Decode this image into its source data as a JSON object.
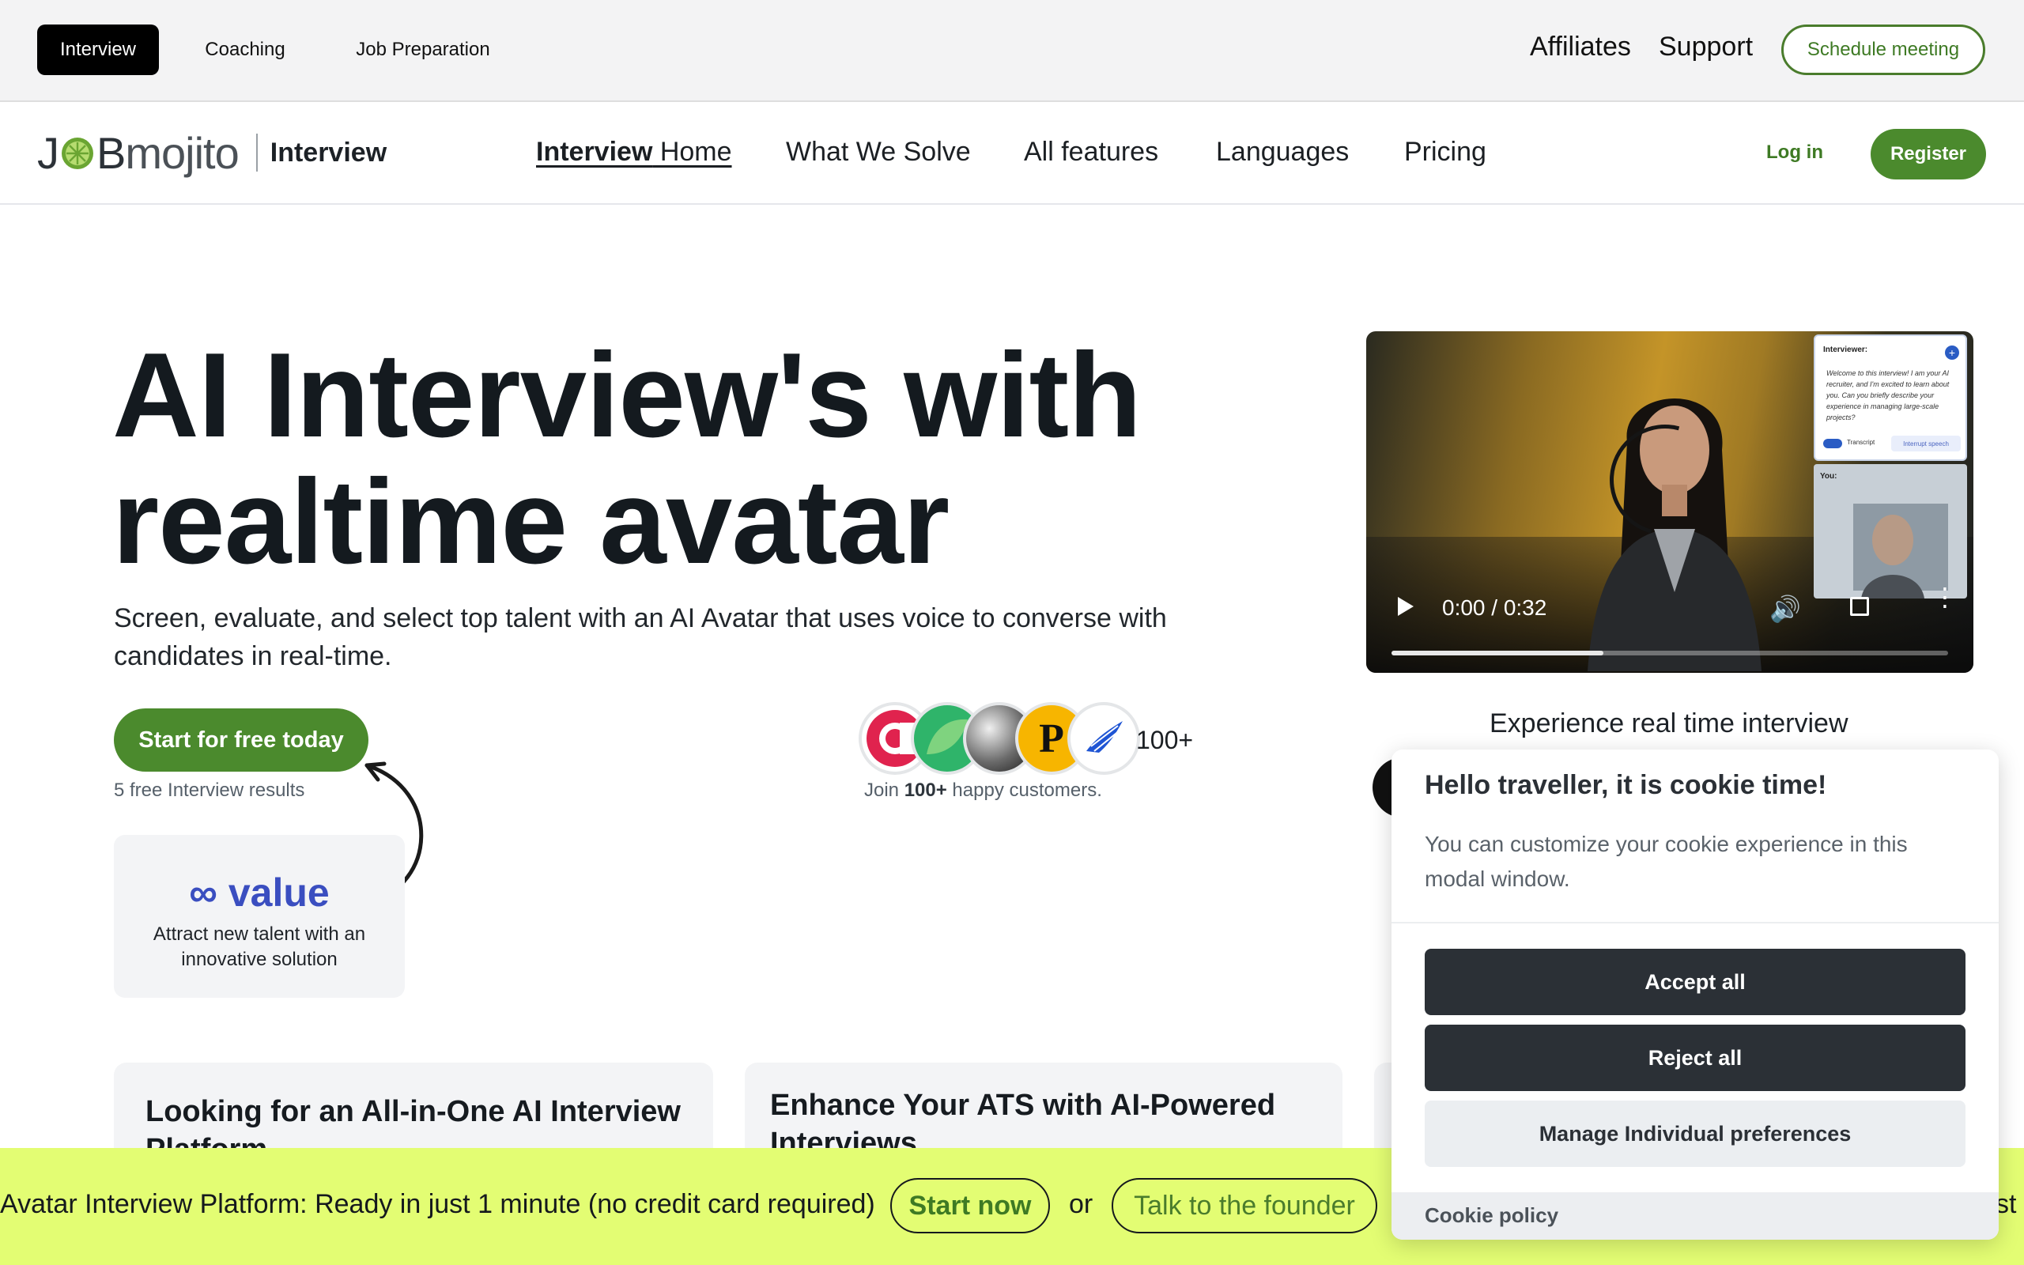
{
  "topbar": {
    "tabs": [
      "Interview",
      "Coaching",
      "Job Preparation"
    ],
    "links": [
      "Affiliates",
      "Support"
    ],
    "schedule_label": "Schedule meeting"
  },
  "nav": {
    "logo_jo": "J",
    "logo_b": "B",
    "logo_mojito": "mojito",
    "logo_sub": "Interview",
    "home_bold": "Interview",
    "home_rest": " Home",
    "links": [
      "What We Solve",
      "All features",
      "Languages",
      "Pricing"
    ],
    "login": "Log in",
    "register": "Register"
  },
  "hero": {
    "title_line1": "AI Interview's with",
    "title_line2": "realtime avatar",
    "subtitle": "Screen, evaluate, and select top talent with an AI Avatar that uses voice to converse with candidates in real-time.",
    "cta": "Start for free today",
    "cta_note": "5 free Interview results",
    "value_symbol": "∞",
    "value_word": "value",
    "value_desc": "Attract new talent with an innovative solution"
  },
  "customers": {
    "count": "100+",
    "note_prefix": "Join ",
    "note_bold": "100+",
    "note_suffix": " happy customers.",
    "avatar_letter": "P"
  },
  "video": {
    "panel_title": "Interviewer:",
    "panel_text": "Welcome to this interview! I am your AI recruiter, and I'm excited to learn about you. Can you briefly describe your experience in managing large-scale projects?",
    "transcript_label": "Transcript",
    "interrupt_label": "Interrupt speech",
    "you_label": "You:",
    "time": "0:00 / 0:32",
    "progress": 0.38,
    "caption": "Experience real time interview"
  },
  "features": [
    {
      "title": "Looking for an All-in-One AI Interview Platform"
    },
    {
      "title": "Enhance Your ATS with AI-Powered Interviews"
    }
  ],
  "banner": {
    "text": "Avatar Interview Platform: Ready in just 1 minute (no credit card required)",
    "start": "Start now",
    "or": "or",
    "founder": "Talk to the founder",
    "tail": "st"
  },
  "cookie": {
    "title": "Hello traveller, it is cookie time!",
    "desc": "You can customize your cookie experience in this modal window.",
    "accept": "Accept all",
    "reject": "Reject all",
    "manage": "Manage Individual preferences",
    "policy": "Cookie policy"
  },
  "colors": {
    "brand_green": "#4b8a2d",
    "banner_lime": "#e3fd73",
    "value_blue": "#3a4ec0",
    "dark_button": "#2b3036"
  }
}
